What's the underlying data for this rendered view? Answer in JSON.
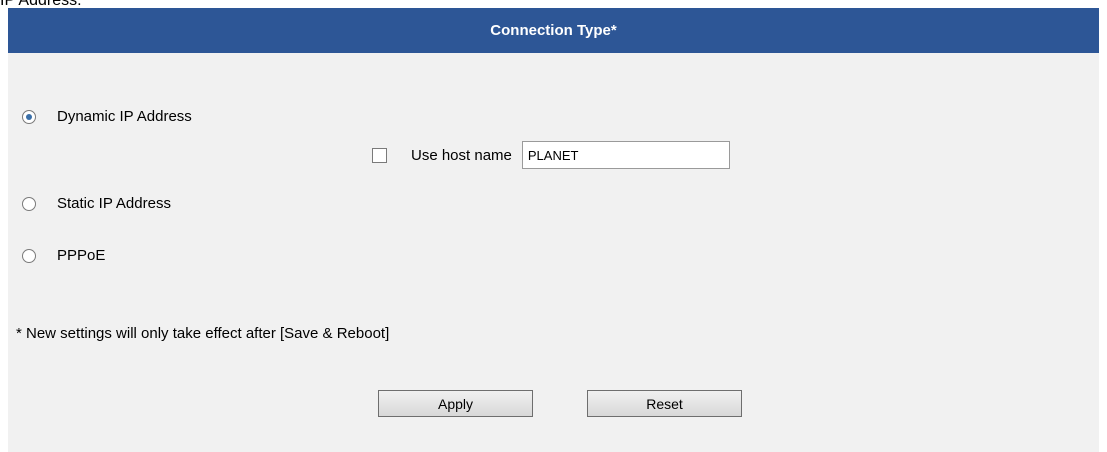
{
  "top_caption": "IP Address.",
  "header": {
    "title": "Connection Type*"
  },
  "options": [
    {
      "label": "Dynamic IP Address",
      "selected": true
    },
    {
      "label": "Static IP Address",
      "selected": false
    },
    {
      "label": "PPPoE",
      "selected": false
    }
  ],
  "hostname": {
    "checkbox_label": "Use host name",
    "checked": false,
    "value": "PLANET"
  },
  "note": "* New settings will only take effect after [Save & Reboot]",
  "buttons": {
    "apply": "Apply",
    "reset": "Reset"
  },
  "colors": {
    "header_bg": "#2d5696",
    "panel_bg": "#f1f1f1"
  }
}
